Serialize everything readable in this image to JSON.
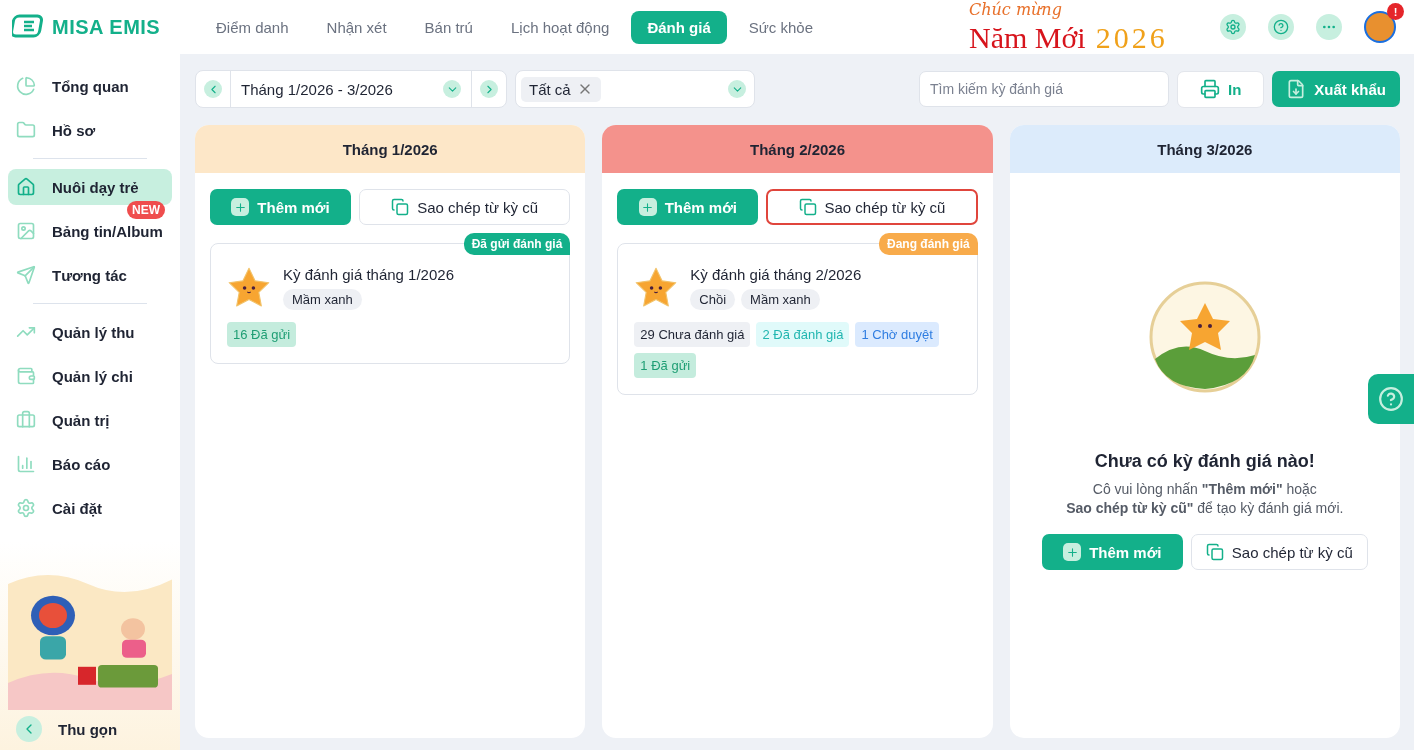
{
  "brand": {
    "name": "MISA EMIS"
  },
  "nav_tabs": [
    {
      "label": "Điểm danh",
      "selected": false
    },
    {
      "label": "Nhận xét",
      "selected": false
    },
    {
      "label": "Bán trú",
      "selected": false
    },
    {
      "label": "Lịch hoạt động",
      "selected": false
    },
    {
      "label": "Đánh giá",
      "selected": true
    },
    {
      "label": "Sức khỏe",
      "selected": false
    }
  ],
  "banner": {
    "greeting": "Chúc mừng",
    "title": "Năm Mới",
    "year": "2026"
  },
  "notification_badge": "!",
  "sidebar": {
    "groups": [
      [
        {
          "label": "Tổng quan",
          "selected": false
        },
        {
          "label": "Hồ sơ",
          "selected": false
        }
      ],
      [
        {
          "label": "Nuôi dạy trẻ",
          "selected": true
        },
        {
          "label": "Bảng tin/Album",
          "selected": false,
          "badge": "NEW"
        },
        {
          "label": "Tương tác",
          "selected": false
        }
      ],
      [
        {
          "label": "Quản lý thu",
          "selected": false
        },
        {
          "label": "Quản lý chi",
          "selected": false
        },
        {
          "label": "Quản trị",
          "selected": false
        },
        {
          "label": "Báo cáo",
          "selected": false
        },
        {
          "label": "Cài đặt",
          "selected": false
        }
      ]
    ],
    "collapse": "Thu gọn"
  },
  "toolbar": {
    "period": "Tháng 1/2026 - 3/2026",
    "filter_tag": "Tất cả",
    "search": {
      "placeholder": "Tìm kiếm kỳ đánh giá"
    },
    "print": "In",
    "export": "Xuất khẩu"
  },
  "columns": [
    {
      "title": "Tháng 1/2026",
      "color": "#fde7c8",
      "add_label": "Thêm mới",
      "copy_label": "Sao chép từ kỳ cũ",
      "copy_highlighted": false,
      "periods": [
        {
          "title": "Kỳ đánh giá tháng 1/2026",
          "status": {
            "label": "Đã gửi đánh giá",
            "color": "#13b08a"
          },
          "classes": [
            "Mầm xanh"
          ],
          "counts": [
            {
              "label": "16 Đã gửi",
              "kind": "sent"
            }
          ]
        }
      ]
    },
    {
      "title": "Tháng 2/2026",
      "color": "#f4928c",
      "add_label": "Thêm mới",
      "copy_label": "Sao chép từ kỳ cũ",
      "copy_highlighted": true,
      "periods": [
        {
          "title": "Kỳ đánh giá tháng 2/2026",
          "status": {
            "label": "Đang đánh giá",
            "color": "#f8ab4b"
          },
          "classes": [
            "Chồi",
            "Mầm xanh"
          ],
          "counts": [
            {
              "label": "29 Chưa đánh giá",
              "kind": "pending"
            },
            {
              "label": "2 Đã đánh giá",
              "kind": "graded"
            },
            {
              "label": "1 Chờ duyệt",
              "kind": "review"
            },
            {
              "label": "1 Đã gửi",
              "kind": "sent"
            }
          ]
        }
      ]
    },
    {
      "title": "Tháng 3/2026",
      "color": "#dcebfb",
      "empty": {
        "heading": "Chưa có kỳ đánh giá nào!",
        "lines": [
          "Cô vui lòng nhấn **\"Thêm mới\"** hoặc",
          "**Sao chép từ kỳ cũ\"** để tạo kỳ đánh giá mới."
        ],
        "add_label": "Thêm mới",
        "copy_label": "Sao chép từ kỳ cũ"
      }
    }
  ]
}
